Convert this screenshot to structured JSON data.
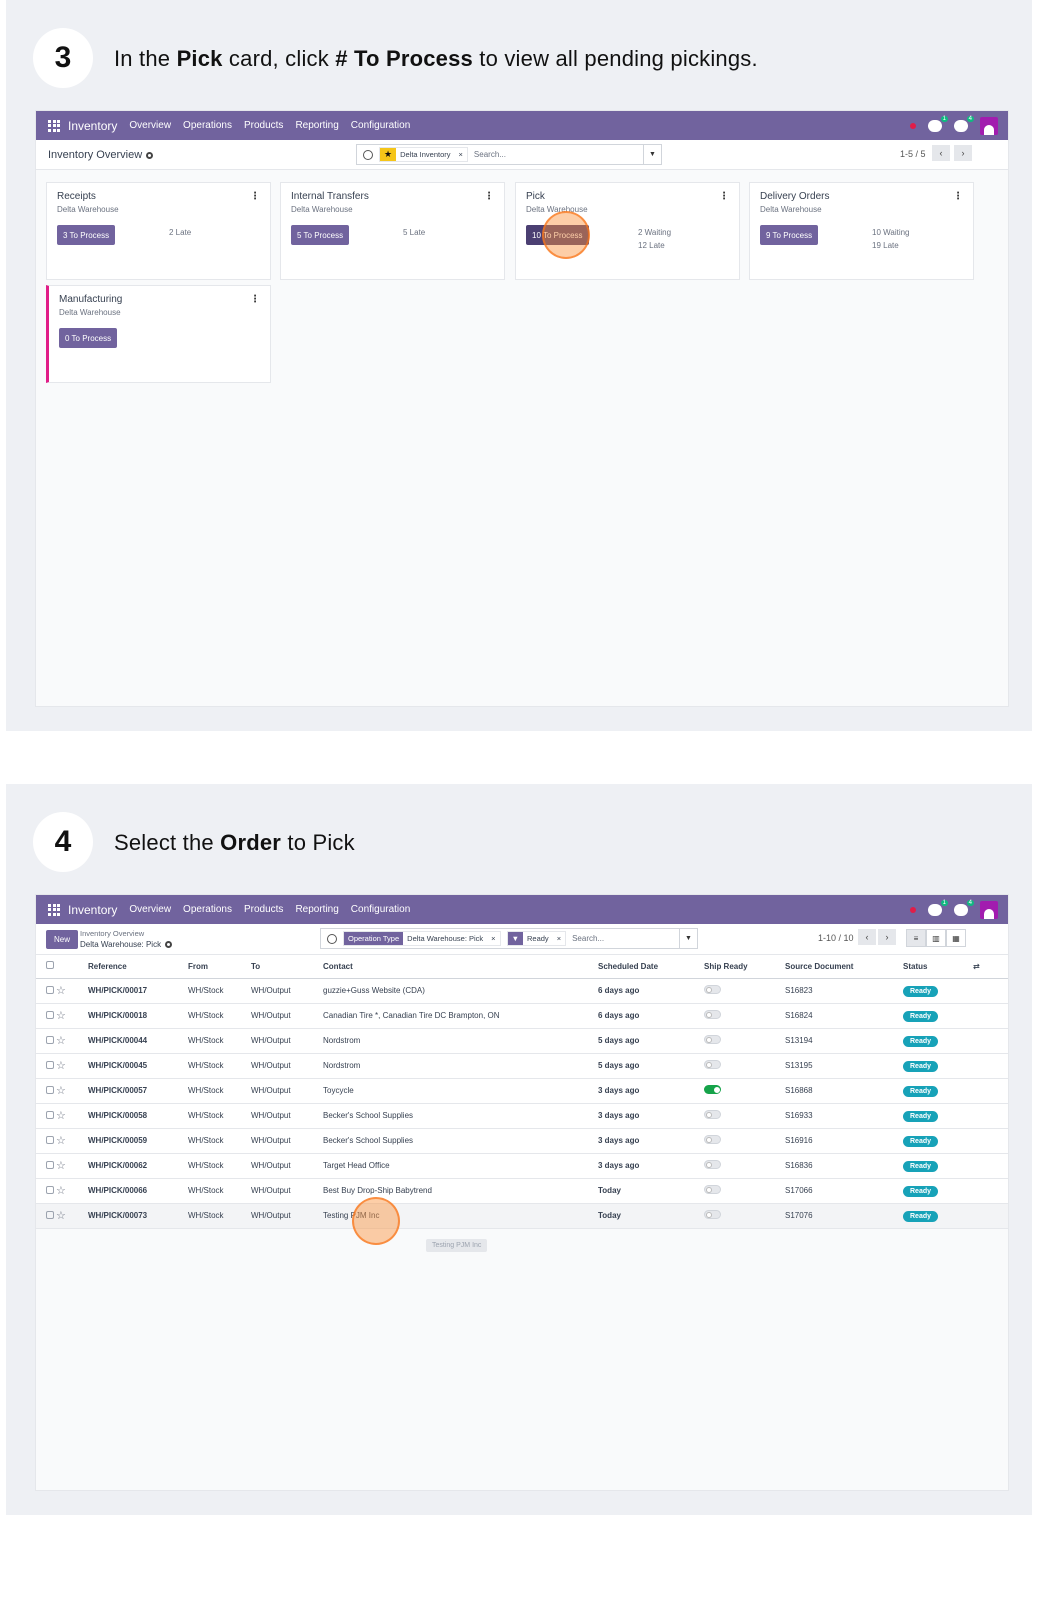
{
  "step3": {
    "number": "3",
    "text_a": "In the ",
    "text_b": "Pick",
    "text_c": " card,  click ",
    "text_d": "# To Process",
    "text_e": " to view all pending pickings.",
    "app": {
      "brand": "Inventory",
      "menu": [
        "Overview",
        "Operations",
        "Products",
        "Reporting",
        "Configuration"
      ],
      "title": "Inventory Overview",
      "filter": "Delta Inventory",
      "search_placeholder": "Search...",
      "pager": "1-5 / 5",
      "cards": [
        {
          "title": "Receipts",
          "sub": "Delta Warehouse",
          "btn": "3 To Process",
          "s1": "2 Late",
          "s2": ""
        },
        {
          "title": "Internal Transfers",
          "sub": "Delta Warehouse",
          "btn": "5 To Process",
          "s1": "5 Late",
          "s2": ""
        },
        {
          "title": "Pick",
          "sub": "Delta Warehouse",
          "btn": "10 To Process",
          "s1": "2 Waiting",
          "s2": "12 Late"
        },
        {
          "title": "Delivery Orders",
          "sub": "Delta Warehouse",
          "btn": "9 To Process",
          "s1": "10 Waiting",
          "s2": "19 Late"
        },
        {
          "title": "Manufacturing",
          "sub": "Delta Warehouse",
          "btn": "0 To Process",
          "s1": "",
          "s2": ""
        }
      ]
    }
  },
  "step4": {
    "number": "4",
    "text_a": "Select the ",
    "text_b": "Order",
    "text_c": " to Pick",
    "app": {
      "brand": "Inventory",
      "menu": [
        "Overview",
        "Operations",
        "Products",
        "Reporting",
        "Configuration"
      ],
      "new_label": "New",
      "breadcrumb_parent": "Inventory Overview",
      "breadcrumb_current": "Delta Warehouse: Pick",
      "facet1_label": "Operation Type",
      "facet1_value": "Delta Warehouse: Pick",
      "facet2_value": "Ready",
      "search_placeholder": "Search...",
      "pager": "1-10 / 10",
      "columns": [
        "Reference",
        "From",
        "To",
        "Contact",
        "Scheduled Date",
        "Ship Ready",
        "Source Document",
        "Status"
      ],
      "rows": [
        {
          "ref": "WH/PICK/00017",
          "from": "WH/Stock",
          "to": "WH/Output",
          "contact": "guzzie+Guss Website (CDA)",
          "date": "6 days ago",
          "late": true,
          "ready": false,
          "src": "S16823",
          "status": "Ready"
        },
        {
          "ref": "WH/PICK/00018",
          "from": "WH/Stock",
          "to": "WH/Output",
          "contact": "Canadian Tire *, Canadian Tire DC Brampton, ON",
          "date": "6 days ago",
          "late": true,
          "ready": false,
          "src": "S16824",
          "status": "Ready"
        },
        {
          "ref": "WH/PICK/00044",
          "from": "WH/Stock",
          "to": "WH/Output",
          "contact": "Nordstrom",
          "date": "5 days ago",
          "late": true,
          "ready": false,
          "src": "S13194",
          "status": "Ready"
        },
        {
          "ref": "WH/PICK/00045",
          "from": "WH/Stock",
          "to": "WH/Output",
          "contact": "Nordstrom",
          "date": "5 days ago",
          "late": true,
          "ready": false,
          "src": "S13195",
          "status": "Ready"
        },
        {
          "ref": "WH/PICK/00057",
          "from": "WH/Stock",
          "to": "WH/Output",
          "contact": "Toycycle",
          "date": "3 days ago",
          "late": true,
          "ready": true,
          "src": "S16868",
          "status": "Ready"
        },
        {
          "ref": "WH/PICK/00058",
          "from": "WH/Stock",
          "to": "WH/Output",
          "contact": "Becker's School Supplies",
          "date": "3 days ago",
          "late": true,
          "ready": false,
          "src": "S16933",
          "status": "Ready"
        },
        {
          "ref": "WH/PICK/00059",
          "from": "WH/Stock",
          "to": "WH/Output",
          "contact": "Becker's School Supplies",
          "date": "3 days ago",
          "late": true,
          "ready": false,
          "src": "S16916",
          "status": "Ready"
        },
        {
          "ref": "WH/PICK/00062",
          "from": "WH/Stock",
          "to": "WH/Output",
          "contact": "Target Head Office",
          "date": "3 days ago",
          "late": true,
          "ready": false,
          "src": "S16836",
          "status": "Ready"
        },
        {
          "ref": "WH/PICK/00066",
          "from": "WH/Stock",
          "to": "WH/Output",
          "contact": "Best Buy Drop-Ship Babytrend",
          "date": "Today",
          "late": false,
          "ready": false,
          "src": "S17066",
          "status": "Ready"
        },
        {
          "ref": "WH/PICK/00073",
          "from": "WH/Stock",
          "to": "WH/Output",
          "contact": "Testing PJM Inc",
          "date": "Today",
          "late": false,
          "ready": false,
          "src": "S17076",
          "status": "Ready"
        }
      ],
      "tooltip": "Testing PJM Inc"
    }
  }
}
